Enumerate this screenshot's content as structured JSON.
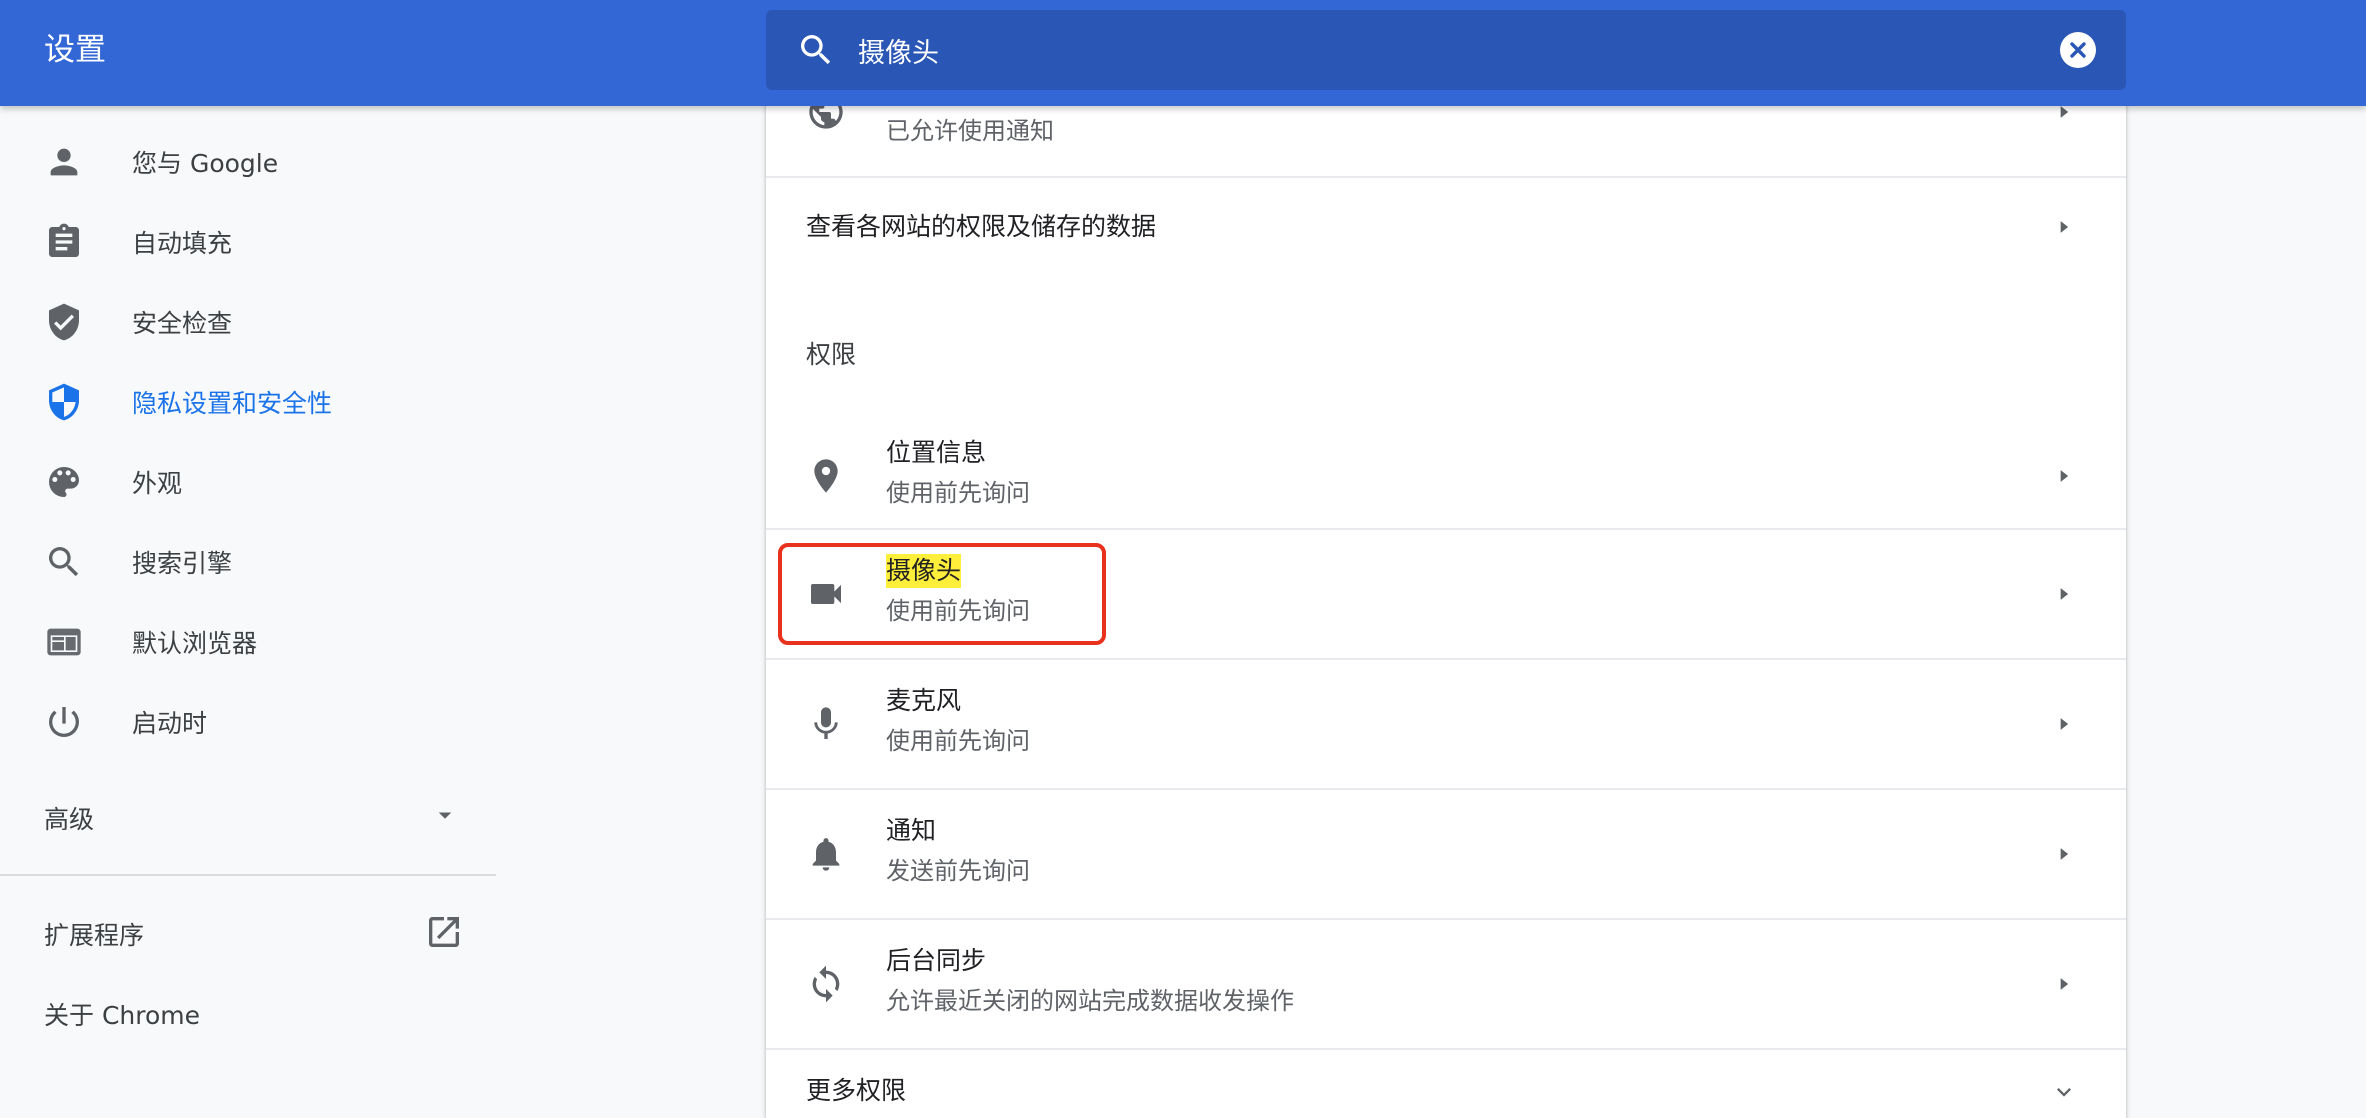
{
  "header": {
    "title": "设置",
    "search_value": "摄像头"
  },
  "sidebar": {
    "items": [
      {
        "label": "您与 Google",
        "icon": "person-icon"
      },
      {
        "label": "自动填充",
        "icon": "clipboard-icon"
      },
      {
        "label": "安全检查",
        "icon": "shield-check-icon"
      },
      {
        "label": "隐私设置和安全性",
        "icon": "shield-half-icon",
        "active": true
      },
      {
        "label": "外观",
        "icon": "palette-icon"
      },
      {
        "label": "搜索引擎",
        "icon": "search-icon"
      },
      {
        "label": "默认浏览器",
        "icon": "browser-window-icon"
      },
      {
        "label": "启动时",
        "icon": "power-icon"
      }
    ],
    "advanced_label": "高级",
    "extensions_label": "扩展程序",
    "about_label": "关于 Chrome"
  },
  "main": {
    "notifications_top_sub": "已允许使用通知",
    "site_data_label": "查看各网站的权限及储存的数据",
    "permissions_section": "权限",
    "permissions": [
      {
        "title": "位置信息",
        "sub": "使用前先询问",
        "icon": "location-pin-icon"
      },
      {
        "title": "摄像头",
        "sub": "使用前先询问",
        "icon": "camera-icon"
      },
      {
        "title": "麦克风",
        "sub": "使用前先询问",
        "icon": "microphone-icon"
      },
      {
        "title": "通知",
        "sub": "发送前先询问",
        "icon": "bell-icon"
      },
      {
        "title": "后台同步",
        "sub": "允许最近关闭的网站完成数据收发操作",
        "icon": "sync-icon"
      }
    ],
    "more_permissions_label": "更多权限"
  },
  "colors": {
    "header_bg": "#3367d6",
    "search_bg": "#2a56b5",
    "active_blue": "#1a73e8",
    "highlight": "#ffef3a",
    "focus_outline": "#e8321e"
  }
}
